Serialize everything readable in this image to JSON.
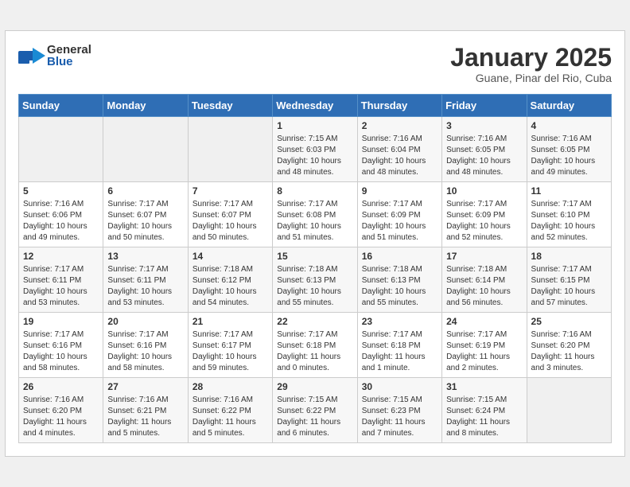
{
  "header": {
    "logo_general": "General",
    "logo_blue": "Blue",
    "title": "January 2025",
    "subtitle": "Guane, Pinar del Rio, Cuba"
  },
  "weekdays": [
    "Sunday",
    "Monday",
    "Tuesday",
    "Wednesday",
    "Thursday",
    "Friday",
    "Saturday"
  ],
  "weeks": [
    [
      {
        "day": "",
        "info": ""
      },
      {
        "day": "",
        "info": ""
      },
      {
        "day": "",
        "info": ""
      },
      {
        "day": "1",
        "info": "Sunrise: 7:15 AM\nSunset: 6:03 PM\nDaylight: 10 hours\nand 48 minutes."
      },
      {
        "day": "2",
        "info": "Sunrise: 7:16 AM\nSunset: 6:04 PM\nDaylight: 10 hours\nand 48 minutes."
      },
      {
        "day": "3",
        "info": "Sunrise: 7:16 AM\nSunset: 6:05 PM\nDaylight: 10 hours\nand 48 minutes."
      },
      {
        "day": "4",
        "info": "Sunrise: 7:16 AM\nSunset: 6:05 PM\nDaylight: 10 hours\nand 49 minutes."
      }
    ],
    [
      {
        "day": "5",
        "info": "Sunrise: 7:16 AM\nSunset: 6:06 PM\nDaylight: 10 hours\nand 49 minutes."
      },
      {
        "day": "6",
        "info": "Sunrise: 7:17 AM\nSunset: 6:07 PM\nDaylight: 10 hours\nand 50 minutes."
      },
      {
        "day": "7",
        "info": "Sunrise: 7:17 AM\nSunset: 6:07 PM\nDaylight: 10 hours\nand 50 minutes."
      },
      {
        "day": "8",
        "info": "Sunrise: 7:17 AM\nSunset: 6:08 PM\nDaylight: 10 hours\nand 51 minutes."
      },
      {
        "day": "9",
        "info": "Sunrise: 7:17 AM\nSunset: 6:09 PM\nDaylight: 10 hours\nand 51 minutes."
      },
      {
        "day": "10",
        "info": "Sunrise: 7:17 AM\nSunset: 6:09 PM\nDaylight: 10 hours\nand 52 minutes."
      },
      {
        "day": "11",
        "info": "Sunrise: 7:17 AM\nSunset: 6:10 PM\nDaylight: 10 hours\nand 52 minutes."
      }
    ],
    [
      {
        "day": "12",
        "info": "Sunrise: 7:17 AM\nSunset: 6:11 PM\nDaylight: 10 hours\nand 53 minutes."
      },
      {
        "day": "13",
        "info": "Sunrise: 7:17 AM\nSunset: 6:11 PM\nDaylight: 10 hours\nand 53 minutes."
      },
      {
        "day": "14",
        "info": "Sunrise: 7:18 AM\nSunset: 6:12 PM\nDaylight: 10 hours\nand 54 minutes."
      },
      {
        "day": "15",
        "info": "Sunrise: 7:18 AM\nSunset: 6:13 PM\nDaylight: 10 hours\nand 55 minutes."
      },
      {
        "day": "16",
        "info": "Sunrise: 7:18 AM\nSunset: 6:13 PM\nDaylight: 10 hours\nand 55 minutes."
      },
      {
        "day": "17",
        "info": "Sunrise: 7:18 AM\nSunset: 6:14 PM\nDaylight: 10 hours\nand 56 minutes."
      },
      {
        "day": "18",
        "info": "Sunrise: 7:17 AM\nSunset: 6:15 PM\nDaylight: 10 hours\nand 57 minutes."
      }
    ],
    [
      {
        "day": "19",
        "info": "Sunrise: 7:17 AM\nSunset: 6:16 PM\nDaylight: 10 hours\nand 58 minutes."
      },
      {
        "day": "20",
        "info": "Sunrise: 7:17 AM\nSunset: 6:16 PM\nDaylight: 10 hours\nand 58 minutes."
      },
      {
        "day": "21",
        "info": "Sunrise: 7:17 AM\nSunset: 6:17 PM\nDaylight: 10 hours\nand 59 minutes."
      },
      {
        "day": "22",
        "info": "Sunrise: 7:17 AM\nSunset: 6:18 PM\nDaylight: 11 hours\nand 0 minutes."
      },
      {
        "day": "23",
        "info": "Sunrise: 7:17 AM\nSunset: 6:18 PM\nDaylight: 11 hours\nand 1 minute."
      },
      {
        "day": "24",
        "info": "Sunrise: 7:17 AM\nSunset: 6:19 PM\nDaylight: 11 hours\nand 2 minutes."
      },
      {
        "day": "25",
        "info": "Sunrise: 7:16 AM\nSunset: 6:20 PM\nDaylight: 11 hours\nand 3 minutes."
      }
    ],
    [
      {
        "day": "26",
        "info": "Sunrise: 7:16 AM\nSunset: 6:20 PM\nDaylight: 11 hours\nand 4 minutes."
      },
      {
        "day": "27",
        "info": "Sunrise: 7:16 AM\nSunset: 6:21 PM\nDaylight: 11 hours\nand 5 minutes."
      },
      {
        "day": "28",
        "info": "Sunrise: 7:16 AM\nSunset: 6:22 PM\nDaylight: 11 hours\nand 5 minutes."
      },
      {
        "day": "29",
        "info": "Sunrise: 7:15 AM\nSunset: 6:22 PM\nDaylight: 11 hours\nand 6 minutes."
      },
      {
        "day": "30",
        "info": "Sunrise: 7:15 AM\nSunset: 6:23 PM\nDaylight: 11 hours\nand 7 minutes."
      },
      {
        "day": "31",
        "info": "Sunrise: 7:15 AM\nSunset: 6:24 PM\nDaylight: 11 hours\nand 8 minutes."
      },
      {
        "day": "",
        "info": ""
      }
    ]
  ]
}
